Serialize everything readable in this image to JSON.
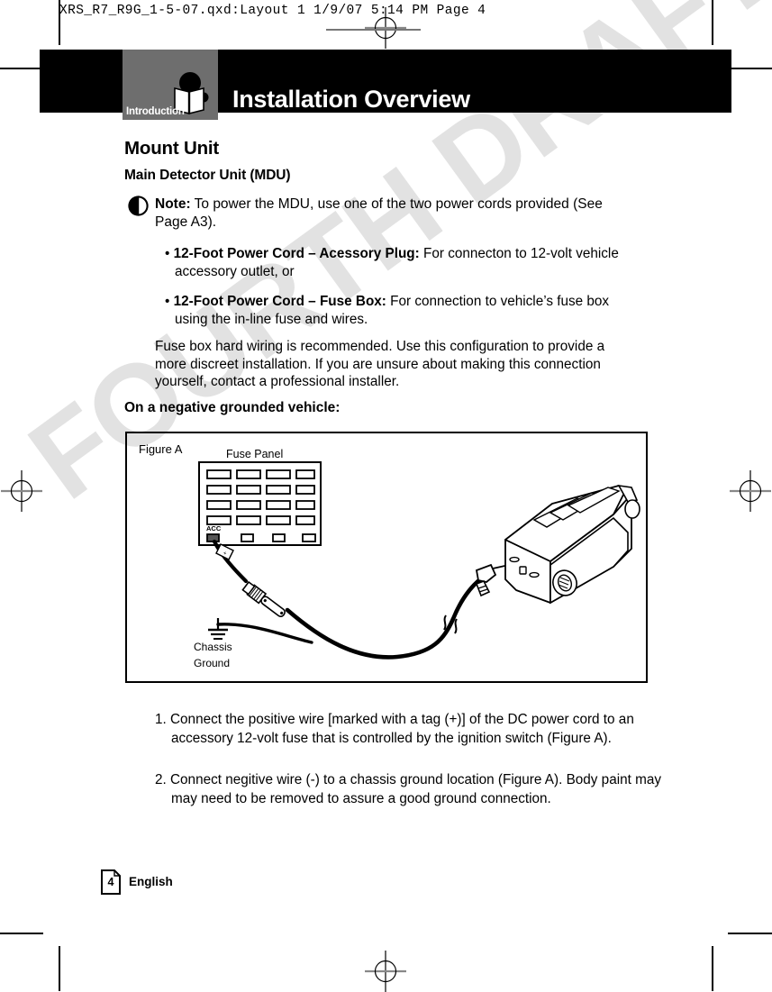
{
  "prepress": {
    "header_line": "XRS_R7_R9G_1-5-07.qxd:Layout 1   1/9/07   5:14 PM   Page 4"
  },
  "watermark": {
    "text": "FOURTH DRAFT",
    "color": "#e2e2e2"
  },
  "banner": {
    "title": "Installation Overview",
    "chapter_tab_label": "Introduction",
    "tab_color": "#6e6e6e",
    "bar_color": "#000000",
    "icon": "open-book-icon"
  },
  "content": {
    "heading_1": "Mount Unit",
    "heading_2": "Main Detector Unit (MDU)",
    "note": {
      "label": "Note:",
      "text": " To power the MDU, use one of the two power cords provided (See Page A3)."
    },
    "bullets": [
      {
        "bold": "12-Foot Power Cord – Acessory Plug:",
        "rest": " For connecton to 12-volt vehicle accessory outlet, or"
      },
      {
        "bold": "12-Foot Power Cord – Fuse Box:",
        "rest": " For connection to vehicle’s fuse box using the in-line fuse and wires."
      }
    ],
    "paragraph": "Fuse box hard wiring is recommended. Use this configuration to provide a more discreet installation. If you are unsure about making this connection yourself, contact a professional installer.",
    "heading_3": "On a negative grounded vehicle:",
    "steps": [
      "1. Connect the positive wire [marked with a tag (+)] of the DC power cord to an accessory 12-volt fuse that is controlled by the ignition switch (Figure A).",
      "2. Connect negitive wire (-) to a chassis ground location (Figure A). Body paint may may need to be removed to assure a good ground connection."
    ]
  },
  "figure": {
    "caption": "Figure A",
    "fuse_panel_label": "Fuse Panel",
    "acc_label": "ACC",
    "chassis_ground_label_line1": "Chassis",
    "chassis_ground_label_line2": "Ground",
    "fuse_rows": 4,
    "fuse_cols": 4,
    "small_slot_count": 4
  },
  "footer": {
    "page_number": "4",
    "language": "English"
  }
}
